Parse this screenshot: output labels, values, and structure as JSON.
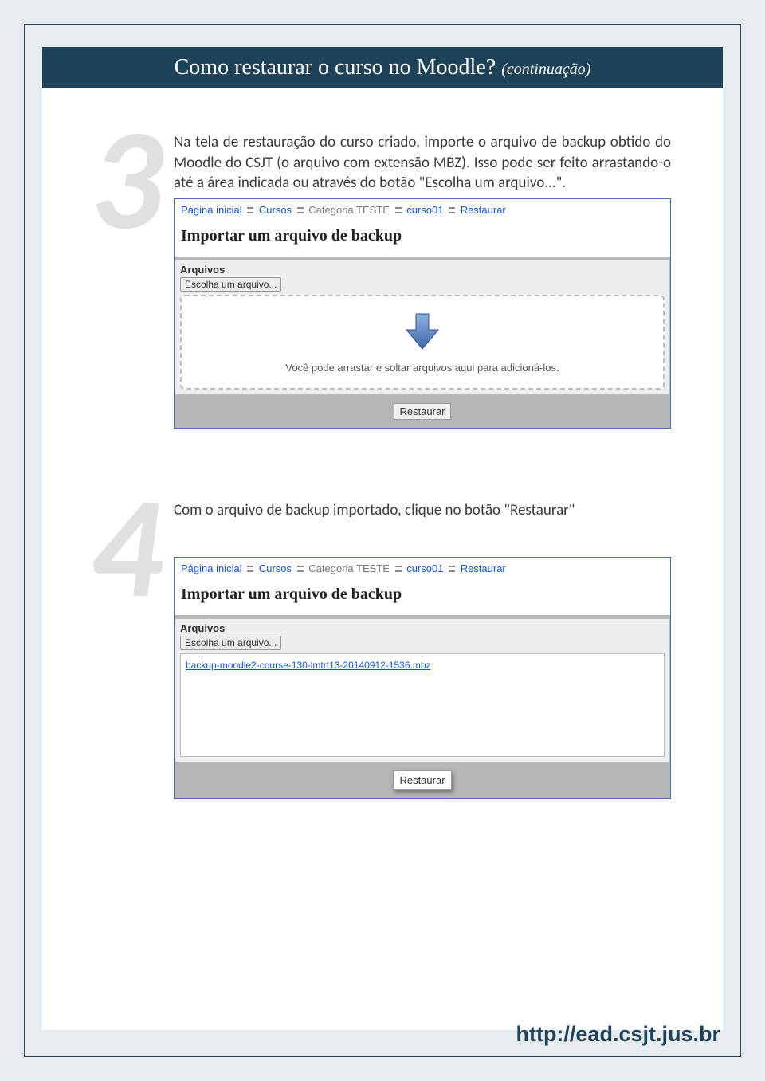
{
  "header": {
    "title": "Como restaurar o curso no Moodle?",
    "suffix": "(continuação)"
  },
  "step3": {
    "number": "3",
    "text": "Na tela de restauração do curso criado, importe o arquivo de backup obtido do Moodle do CSJT (o arquivo com extensão MBZ). Isso pode ser feito arrastando-o até a área indicada ou através do botão \"Escolha um arquivo...\".",
    "screenshot": {
      "breadcrumb": {
        "home": "Página inicial",
        "cursos": "Cursos",
        "categoria": "Categoria TESTE",
        "curso": "curso01",
        "restaurar": "Restaurar"
      },
      "panel_title": "Importar um arquivo de backup",
      "files_legend": "Arquivos",
      "choose_button": "Escolha um arquivo...",
      "dropzone_text": "Você pode arrastar e soltar arquivos aqui para adicioná-los.",
      "restore_button": "Restaurar"
    }
  },
  "step4": {
    "number": "4",
    "text": "Com o arquivo de backup importado, clique no botão \"Restaurar\"",
    "screenshot": {
      "breadcrumb": {
        "home": "Página inicial",
        "cursos": "Cursos",
        "categoria": "Categoria TESTE",
        "curso": "curso01",
        "restaurar": "Restaurar"
      },
      "panel_title": "Importar um arquivo de backup",
      "files_legend": "Arquivos",
      "choose_button": "Escolha um arquivo...",
      "uploaded_file": "backup-moodle2-course-130-lmtrt13-20140912-1536.mbz",
      "restore_button": "Restaurar"
    }
  },
  "footer": {
    "url": "http://ead.csjt.jus.br"
  }
}
